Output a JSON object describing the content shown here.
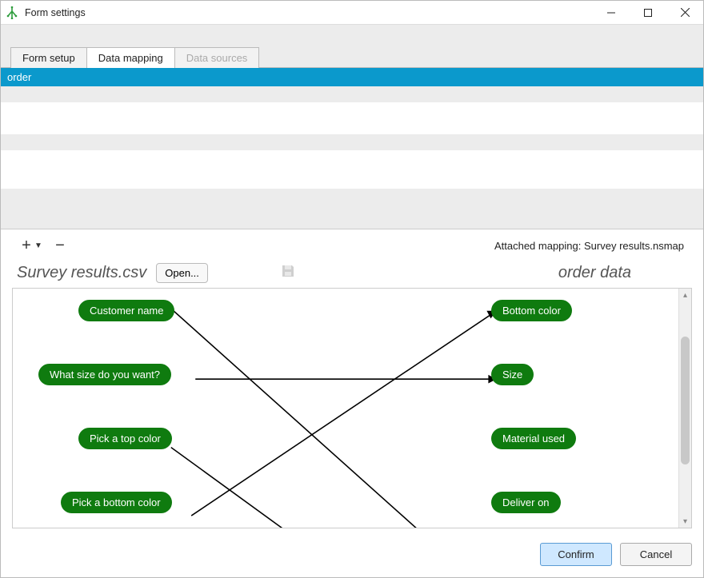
{
  "window": {
    "title": "Form settings"
  },
  "tabs": {
    "form_setup": "Form setup",
    "data_mapping": "Data mapping",
    "data_sources": "Data sources"
  },
  "list": {
    "selected": "order"
  },
  "toolbar": {
    "status_prefix": "Attached mapping: ",
    "status_file": "Survey results.nsmap"
  },
  "mapping": {
    "source_file": "Survey results.csv",
    "open_label": "Open...",
    "target_label": "order data",
    "left": {
      "0": "Customer name",
      "1": "What size do you want?",
      "2": "Pick a top color",
      "3": "Pick a bottom color"
    },
    "right": {
      "0": "Bottom color",
      "1": "Size",
      "2": "Material used",
      "3": "Deliver on"
    },
    "edges": [
      {
        "from": 0,
        "to_below": true
      },
      {
        "from": 1,
        "to": 1
      },
      {
        "from": 2,
        "to_below": true
      },
      {
        "from": 3,
        "to": 0
      }
    ]
  },
  "footer": {
    "confirm": "Confirm",
    "cancel": "Cancel"
  }
}
